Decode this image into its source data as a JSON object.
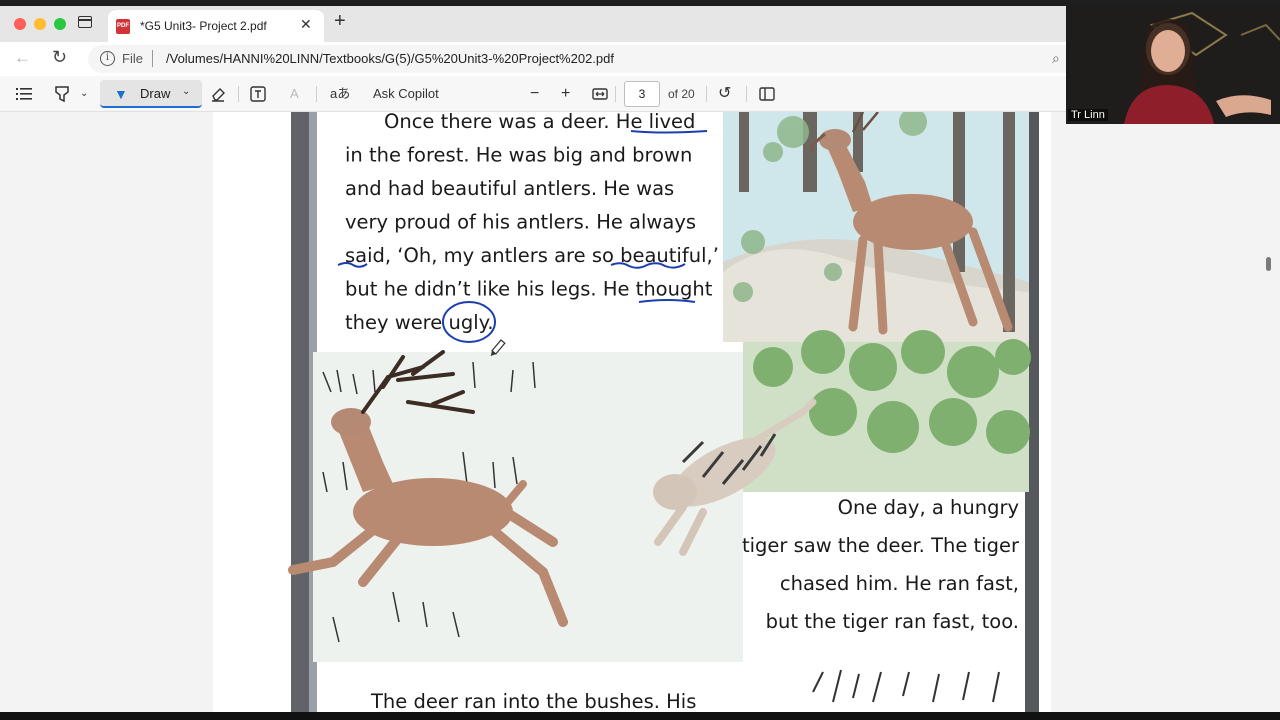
{
  "tab": {
    "title": "*G5 Unit3- Project 2.pdf",
    "file_icon_text": "PDF"
  },
  "address": {
    "scheme": "File",
    "url": "/Volumes/HANNI%20LINN/Textbooks/G(5)/G5%20Unit3-%20Project%202.pdf"
  },
  "toolbar": {
    "draw_label": "Draw",
    "read_aloud_label": "aあ",
    "ask_copilot_label": "Ask Copilot",
    "zoom_out": "−",
    "zoom_in": "+",
    "current_page": "3",
    "page_total": "of 20"
  },
  "video": {
    "participant_name": "Tr Linn"
  },
  "book": {
    "para1_lines": [
      "Once there was a deer. He lived",
      "in the forest. He was big and brown",
      "and had beautiful antlers. He was",
      "very proud of his antlers. He always",
      "said, ‘Oh, my antlers are so beautiful,’",
      "but he didn’t like his legs. He thought",
      "they were ugly."
    ],
    "para2_lines": [
      "One day, a hungry",
      "tiger saw the deer. The tiger",
      "chased him. He ran fast,",
      "but the tiger ran fast, too."
    ],
    "para3_partial": "The deer ran into the bushes. His"
  },
  "colors": {
    "annotation_ink": "#1d3fae",
    "accent": "#1f6fd0"
  }
}
